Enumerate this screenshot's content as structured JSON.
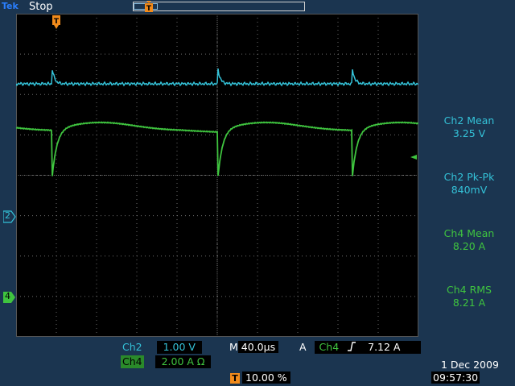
{
  "status": {
    "brand": "Tek",
    "acq_state": "Stop"
  },
  "markers": {
    "ch2": "2",
    "ch4": "4",
    "trigger": "T"
  },
  "measurements": [
    {
      "name": "Ch2 Mean",
      "value": "3.25 V",
      "channel": "ch2"
    },
    {
      "name": "Ch2 Pk-Pk",
      "value": "840mV",
      "channel": "ch2"
    },
    {
      "name": "Ch4 Mean",
      "value": "8.20 A",
      "channel": "ch4"
    },
    {
      "name": "Ch4 RMS",
      "value": "8.21 A",
      "channel": "ch4"
    }
  ],
  "scales": {
    "ch2": {
      "label": "Ch2",
      "value": "1.00 V"
    },
    "ch4": {
      "label": "Ch4",
      "value": "2.00 A Ω"
    },
    "timebase": {
      "prefix": "M",
      "value": "40.0µs"
    },
    "trigger": {
      "mode": "A",
      "source": "Ch4",
      "slope_icon": "rising-edge-icon",
      "level": "7.12 A"
    },
    "trigger_position": {
      "value": "10.00 %"
    }
  },
  "datetime": {
    "date": "1 Dec  2009",
    "time": "09:57:30"
  },
  "colors": {
    "ch2": "#34c2d8",
    "ch4": "#3fc43f",
    "trigger": "#f28b1b",
    "screen_bg": "#000000",
    "frame_bg": "#1b3550"
  }
}
